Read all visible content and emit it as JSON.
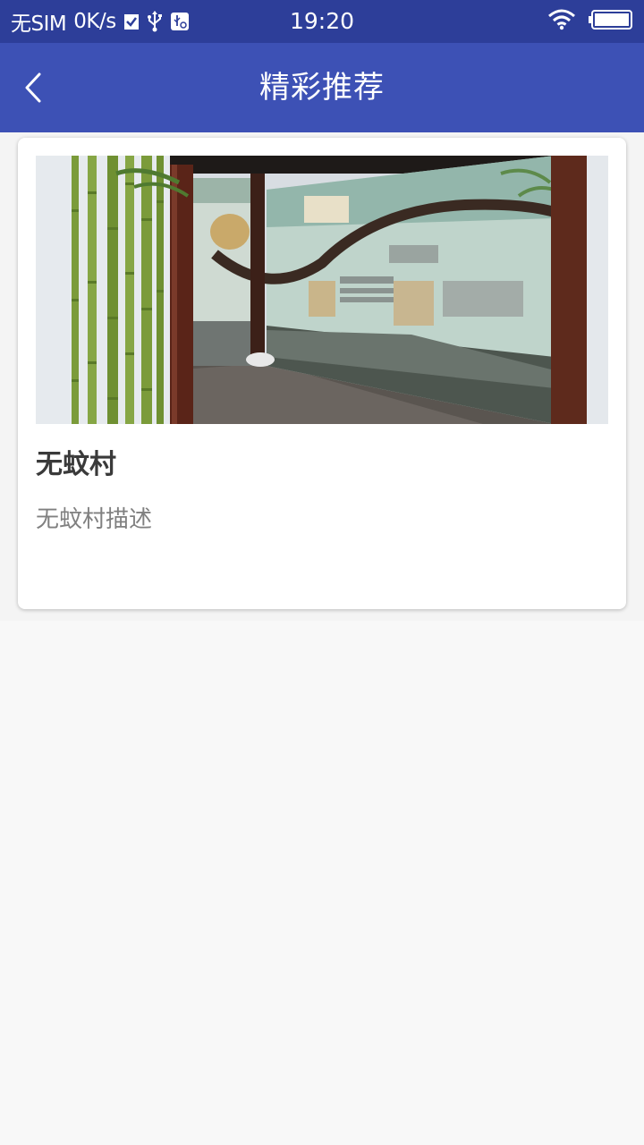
{
  "status_bar": {
    "carrier": "无SIM",
    "speed": "0K/s",
    "time": "19:20",
    "icons": [
      "checkbox-icon",
      "usb-icon",
      "usb-debug-icon",
      "wifi-icon",
      "battery-icon"
    ]
  },
  "app_bar": {
    "title": "精彩推荐",
    "back_icon": "chevron-left-icon",
    "background": "#3d51b5",
    "status_background": "#2d3e99"
  },
  "recommendations": [
    {
      "title": "无蚊村",
      "description": "无蚊村描述",
      "image": "exhibition-hall-photo"
    }
  ]
}
